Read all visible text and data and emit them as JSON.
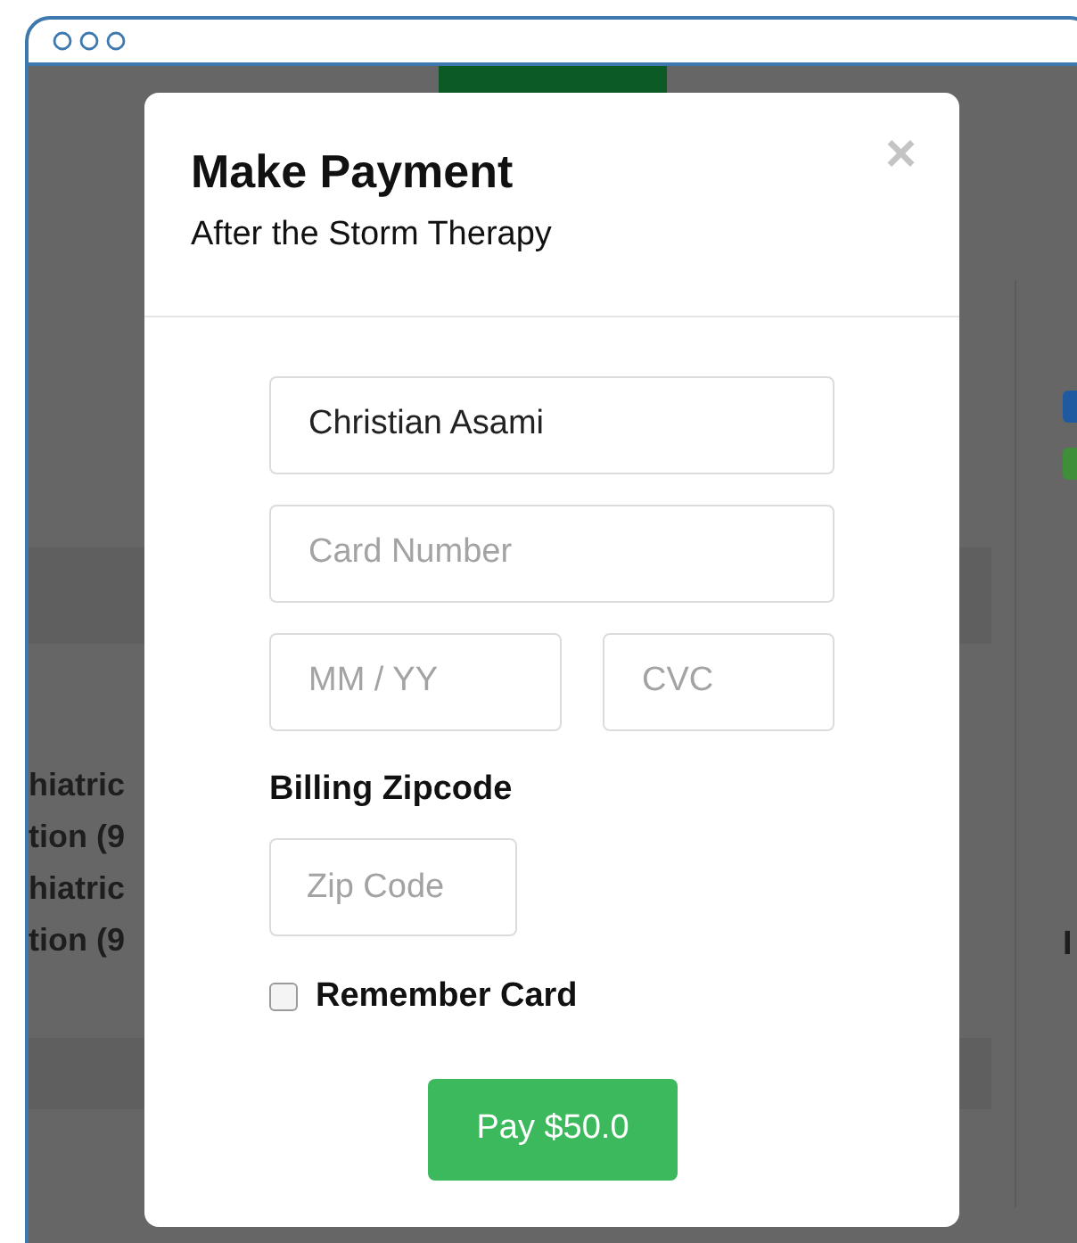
{
  "background": {
    "left_lines": [
      "hiatric",
      "tion (9",
      "hiatric",
      "tion (9"
    ],
    "right_items": [
      {
        "kind": "badge",
        "color": "#1f5aa0"
      },
      {
        "kind": "badge",
        "color": "#3f8f3a"
      },
      {
        "kind": "heading",
        "text": "I"
      }
    ]
  },
  "modal": {
    "title": "Make Payment",
    "subtitle": "After the Storm Therapy",
    "close": "×",
    "name_field": {
      "value": "Christian Asami"
    },
    "card_field": {
      "placeholder": "Card Number"
    },
    "expiry_field": {
      "placeholder": "MM / YY"
    },
    "cvc_field": {
      "placeholder": "CVC"
    },
    "zip_label": "Billing Zipcode",
    "zip_field": {
      "placeholder": "Zip Code"
    },
    "remember": {
      "label": "Remember Card",
      "checked": false
    },
    "pay_button": "Pay $50.0"
  }
}
